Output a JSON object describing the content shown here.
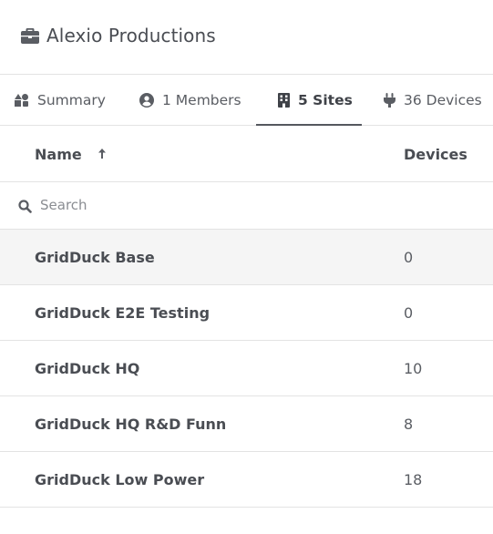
{
  "header": {
    "title": "Alexio Productions",
    "icon": "briefcase-icon"
  },
  "tabs": [
    {
      "label": "Summary",
      "icon": "shapes-icon",
      "active": false
    },
    {
      "label": "1 Members",
      "icon": "user-circle-icon",
      "active": false
    },
    {
      "label": "5 Sites",
      "icon": "building-icon",
      "active": true
    },
    {
      "label": "36 Devices",
      "icon": "plug-icon",
      "active": false
    }
  ],
  "table": {
    "columns": {
      "name": "Name",
      "name_sort": "ascending",
      "devices": "Devices"
    },
    "search": {
      "placeholder": "Search",
      "value": ""
    },
    "rows": [
      {
        "name": "GridDuck Base",
        "devices": "0"
      },
      {
        "name": "GridDuck E2E Testing",
        "devices": "0"
      },
      {
        "name": "GridDuck HQ",
        "devices": "10"
      },
      {
        "name": "GridDuck HQ R&D Funn",
        "devices": "8"
      },
      {
        "name": "GridDuck Low Power",
        "devices": "18"
      }
    ]
  },
  "colors": {
    "text": "#4a4d53",
    "border": "#e3e3e3",
    "hover_row": "#f5f5f5",
    "active_underline": "#55585e"
  }
}
